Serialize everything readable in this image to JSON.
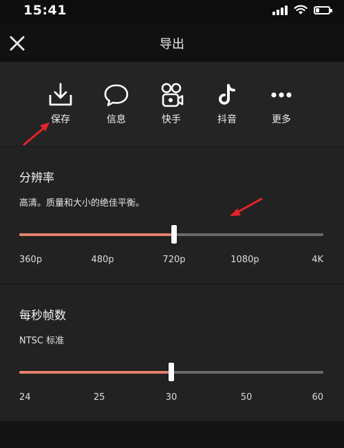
{
  "status_bar": {
    "time": "15:41",
    "battery_level": 0.3
  },
  "header": {
    "title": "导出"
  },
  "share_options": [
    {
      "label": "保存",
      "icon": "save-download-icon"
    },
    {
      "label": "信息",
      "icon": "message-bubble-icon"
    },
    {
      "label": "快手",
      "icon": "kuaishou-icon"
    },
    {
      "label": "抖音",
      "icon": "douyin-icon"
    },
    {
      "label": "更多",
      "icon": "more-dots-icon"
    }
  ],
  "resolution": {
    "title": "分辨率",
    "description": "高清。质量和大小的绝佳平衡。",
    "options": [
      "360p",
      "480p",
      "720p",
      "1080p",
      "4K"
    ],
    "selected": "720p",
    "selected_index": 2
  },
  "frame_rate": {
    "title": "每秒帧数",
    "description": "NTSC 标准",
    "options": [
      "24",
      "25",
      "30",
      "50",
      "60"
    ],
    "selected": "30",
    "selected_index": 2
  },
  "colors": {
    "accent_fill": "#e5816d",
    "annotation_arrow": "#e8232a",
    "track": "#6a6a6a"
  }
}
